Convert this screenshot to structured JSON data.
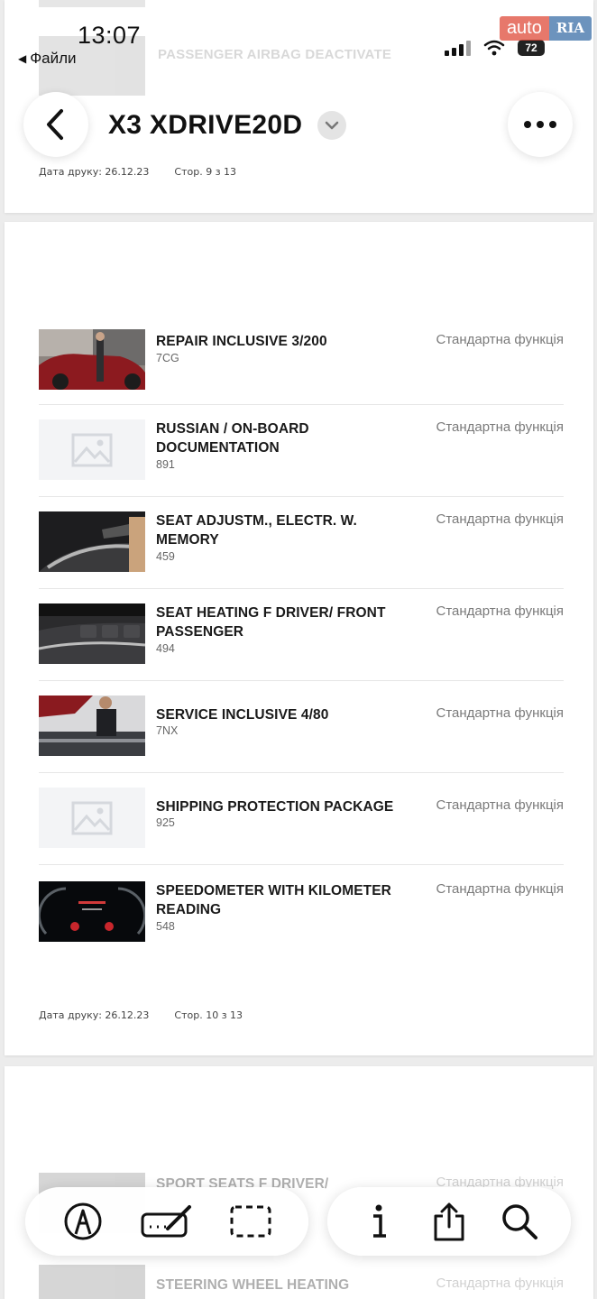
{
  "status_bar": {
    "time": "13:07",
    "back_app": "Файли",
    "battery": "72",
    "watermark_auto": "auto",
    "watermark_ria": "RIA"
  },
  "header": {
    "title": "X3 XDRIVE20D"
  },
  "top_page": {
    "ghost_title": "PASSENGER AIRBAG DEACTIVATE",
    "print_date": "Дата друку: 26.12.23",
    "page_num": "Стор. 9 з 13"
  },
  "main_page": {
    "print_date": "Дата друку: 26.12.23",
    "page_num": "Стор. 10 з 13",
    "options": [
      {
        "name": "REPAIR INCLUSIVE 3/200",
        "code": "7CG",
        "status": "Стандартна функція",
        "thumb": "car-red"
      },
      {
        "name": "RUSSIAN / ON-BOARD DOCUMENTATION",
        "code": "891",
        "status": "Стандартна функція",
        "thumb": "placeholder"
      },
      {
        "name": "SEAT ADJUSTM., ELECTR. W. MEMORY",
        "code": "459",
        "status": "Стандартна функція",
        "thumb": "door-panel"
      },
      {
        "name": "SEAT HEATING F DRIVER/ FRONT PASSENGER",
        "code": "494",
        "status": "Стандартна функція",
        "thumb": "console-buttons"
      },
      {
        "name": "SERVICE INCLUSIVE 4/80",
        "code": "7NX",
        "status": "Стандартна функція",
        "thumb": "mechanic"
      },
      {
        "name": "SHIPPING PROTECTION PACKAGE",
        "code": "925",
        "status": "Стандартна функція",
        "thumb": "placeholder"
      },
      {
        "name": "SPEEDOMETER WITH KILOMETER READING",
        "code": "548",
        "status": "Стандартна функція",
        "thumb": "speedometer"
      }
    ]
  },
  "next_page": {
    "options": [
      {
        "name": "SPORT SEATS F DRIVER/",
        "status": "Стандартна функція"
      },
      {
        "name": "STEERING WHEEL HEATING",
        "status": "Стандартна функція"
      }
    ]
  },
  "toolbar": {
    "left": [
      "markup-pen-icon",
      "signature-icon",
      "select-area-icon"
    ],
    "right": [
      "info-icon",
      "share-icon",
      "search-icon"
    ]
  }
}
